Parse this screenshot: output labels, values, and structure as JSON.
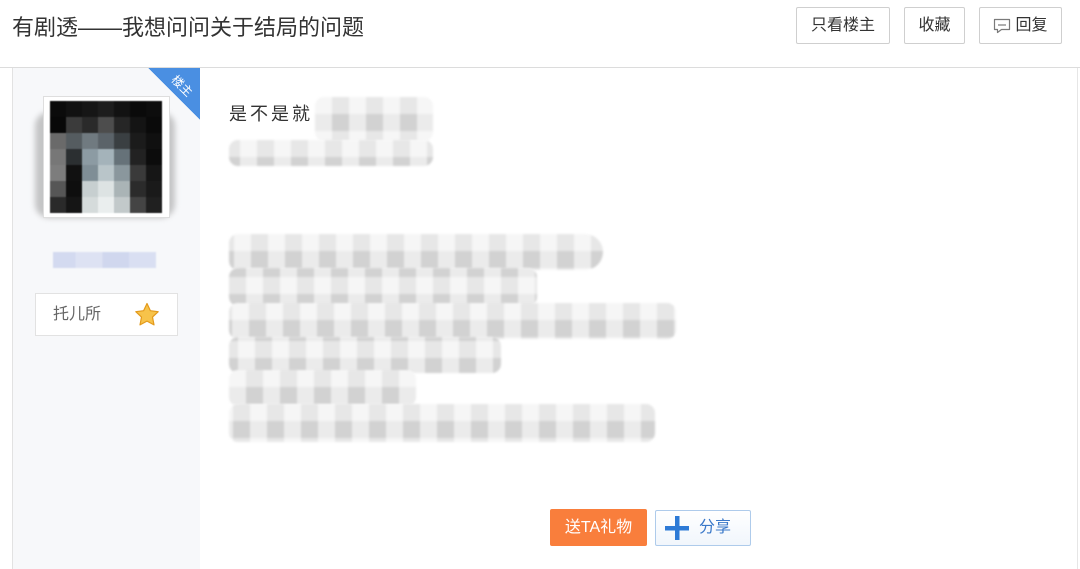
{
  "header": {
    "title": "有剧透——我想问问关于结局的问题",
    "only_op_label": "只看楼主",
    "favorite_label": "收藏",
    "reply_label": "回复",
    "reply_icon": "comment-icon"
  },
  "post": {
    "op_tag": "楼主",
    "author": {
      "badge_label": "托儿所",
      "badge_icon": "level-star-icon"
    },
    "content_first_line": "是不是就",
    "actions": {
      "gift_label": "送TA礼物",
      "share_label": "分享",
      "share_icon": "plus-icon"
    }
  },
  "colors": {
    "op_tag": "#4a8fe2",
    "gift_button": "#f97e3c",
    "share_text": "#3a78c9",
    "sidebar_bg": "#f7f8fa"
  }
}
